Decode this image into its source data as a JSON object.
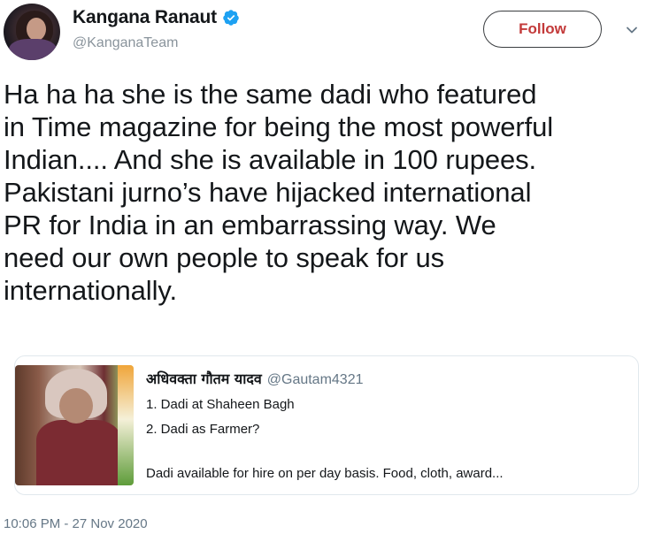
{
  "author": {
    "display_name": "Kangana Ranaut",
    "handle": "@KanganaTeam",
    "verified": true
  },
  "follow_button": {
    "label": "Follow",
    "color": "#c33a3a"
  },
  "tweet": {
    "text": "Ha ha ha she is the same dadi who featured\nin Time magazine for being the most powerful\nIndian.... And she is available in 100 rupees.\nPakistani jurno’s have hijacked international\nPR for India in an embarrassing way. We\nneed our own people to speak for us\ninternationally.",
    "timestamp": "10:06 PM - 27 Nov 2020"
  },
  "quoted_tweet": {
    "display_name": "अधिवक्ता गौतम यादव",
    "handle": "@Gautam4321",
    "line1": "1. Dadi at Shaheen Bagh",
    "line2": "2. Dadi as Farmer?",
    "line3": "Dadi available for hire on per day basis. Food, cloth, award..."
  },
  "icons": {
    "verified": "verified-badge-icon",
    "menu": "chevron-down-icon"
  },
  "colors": {
    "verified_blue": "#1da1f2",
    "text": "#14171a",
    "muted": "#657786"
  }
}
